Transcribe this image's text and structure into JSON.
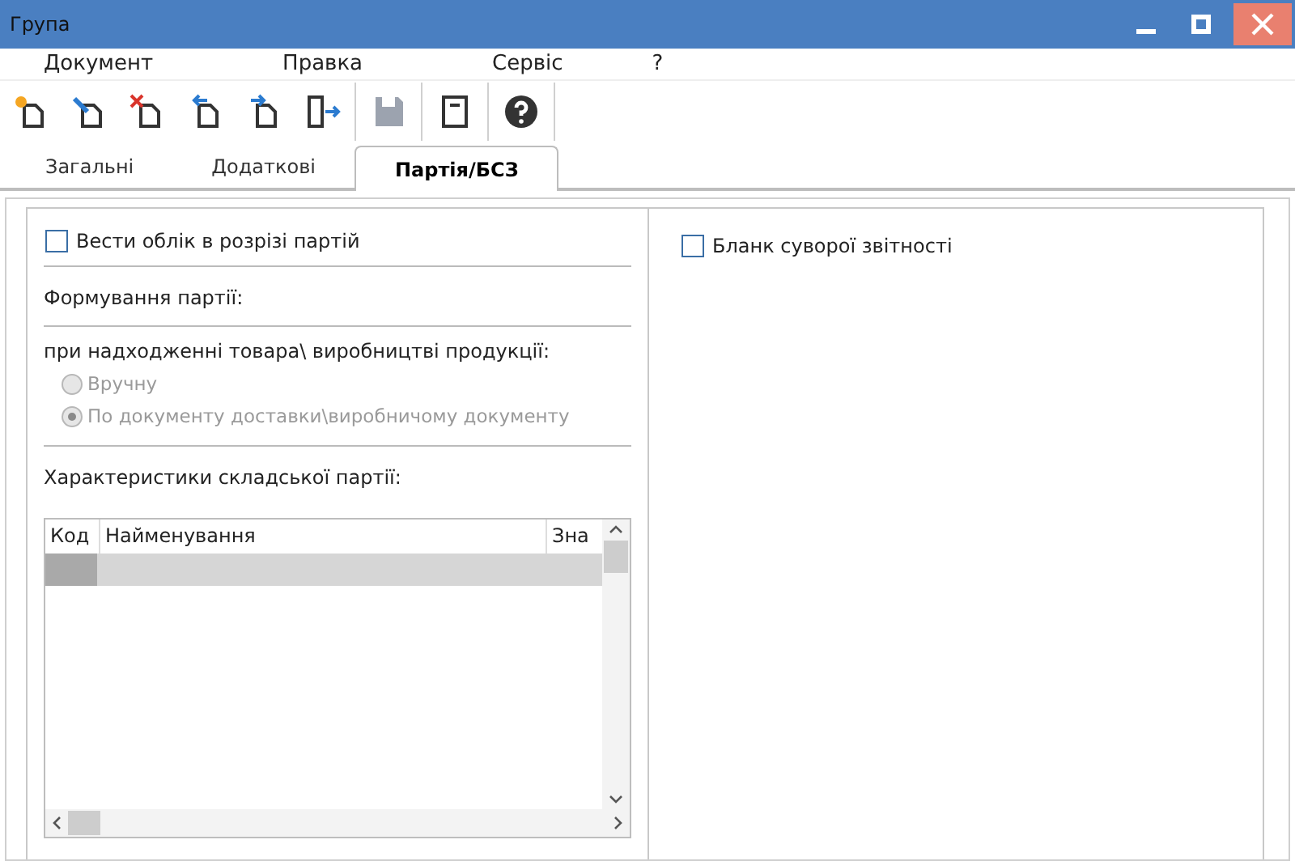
{
  "window": {
    "title": "Група"
  },
  "menu": [
    "Документ",
    "Правка",
    "Сервіс",
    "?"
  ],
  "toolbar": [
    {
      "kind": "new",
      "disabled": false
    },
    {
      "kind": "edit",
      "disabled": false
    },
    {
      "kind": "delete",
      "disabled": false
    },
    {
      "kind": "back",
      "disabled": false
    },
    {
      "kind": "forward",
      "disabled": false
    },
    {
      "kind": "exit",
      "disabled": false
    },
    {
      "kind": "save",
      "disabled": true
    },
    {
      "kind": "notes",
      "disabled": false
    },
    {
      "kind": "help",
      "disabled": false
    }
  ],
  "tabs": [
    {
      "label": "Загальні",
      "selected": false
    },
    {
      "label": "Додаткові",
      "selected": false
    },
    {
      "label": "Партія/БСЗ",
      "selected": true
    }
  ],
  "left": {
    "batch_checkbox": {
      "label": "Вести облік в розрізі партій",
      "checked": false
    },
    "formation_label": "Формування партії:",
    "receipt_label": "при надходженні товара\\ виробництві продукції:",
    "radios": [
      {
        "label": "Вручну",
        "selected": false,
        "disabled": true
      },
      {
        "label": "По документу доставки\\виробничому документу",
        "selected": true,
        "disabled": true
      }
    ],
    "characteristics_label": "Характеристики складської партії:",
    "table": {
      "columns": [
        "Код",
        "Найменування",
        "Зна"
      ]
    }
  },
  "right": {
    "strict_checkbox": {
      "label": "Бланк суворої звітності",
      "checked": false
    }
  }
}
